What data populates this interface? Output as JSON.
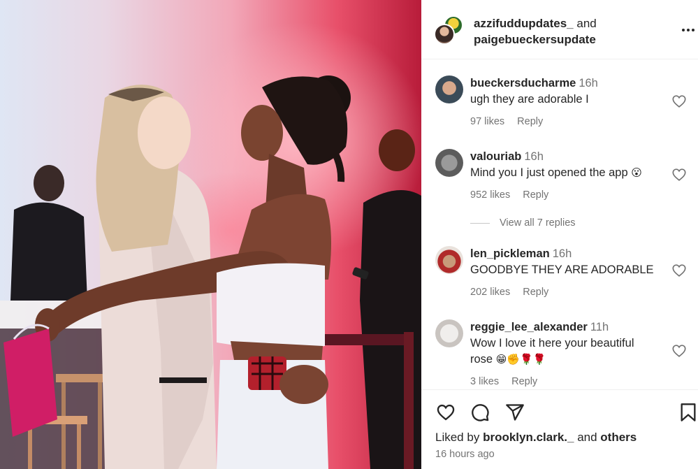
{
  "header": {
    "user1": "azzifuddupdates_",
    "joiner": "and",
    "user2": "paigebueckersupdate"
  },
  "comments": [
    {
      "username": "bueckersducharme",
      "time": "16h",
      "text": "ugh they are adorable I",
      "likes": "97 likes",
      "reply": "Reply"
    },
    {
      "username": "valouriab",
      "time": "16h",
      "text": "Mind you I just opened the app",
      "emoji": "😮",
      "likes": "952 likes",
      "reply": "Reply"
    },
    {
      "username": "len_pickleman",
      "time": "16h",
      "text": "GOODBYE THEY ARE ADORABLE",
      "likes": "202 likes",
      "reply": "Reply"
    },
    {
      "username": "reggie_lee_alexander",
      "time": "11h",
      "text_line1": "Wow I love it here your beautiful",
      "text_line2": "rose",
      "emojis": "😁✊🌹🌹",
      "likes": "3 likes",
      "reply": "Reply"
    }
  ],
  "view_replies": "View all 7 replies",
  "footer": {
    "liked_prefix": "Liked by",
    "liked_user": "brooklyn.clark._",
    "liked_and": "and",
    "liked_others": "others",
    "timestamp": "16 hours ago"
  },
  "icons": {
    "like": "heart-icon",
    "comment": "comment-icon",
    "share": "paper-plane-icon",
    "save": "bookmark-icon",
    "more": "more-options-icon"
  },
  "colors": {
    "text": "#262626",
    "secondary": "#737373",
    "divider": "#efefef"
  }
}
